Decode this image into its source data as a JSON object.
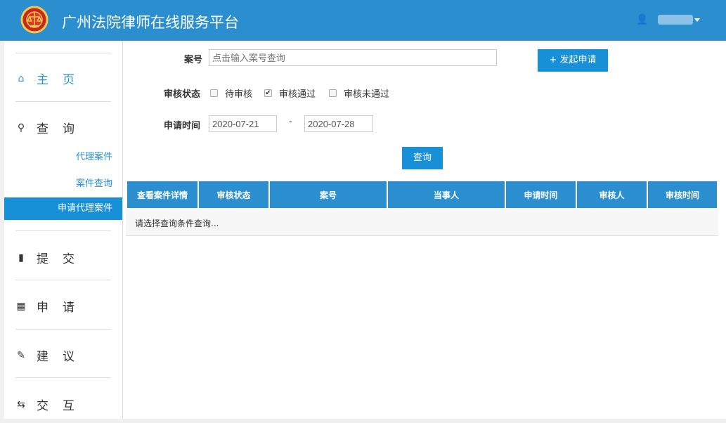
{
  "header": {
    "title": "广州法院律师在线服务平台",
    "user_name": "用户"
  },
  "sidebar": {
    "home": "主页",
    "query": "查询",
    "sub": [
      "代理案件",
      "案件查询",
      "申请代理案件"
    ],
    "submit": "提交",
    "apply": "申请",
    "suggest": "建议",
    "interact": "交互"
  },
  "form": {
    "case_label": "案号",
    "case_placeholder": "点击输入案号查询",
    "case_value": "",
    "new_btn": "+ 发起申请",
    "status_label": "审核状态",
    "status_options": [
      {
        "label": "待审核",
        "checked": false
      },
      {
        "label": "审核通过",
        "checked": true
      },
      {
        "label": "审核未通过",
        "checked": false
      }
    ],
    "date_label": "申请时间",
    "date_from": "2020-07-21",
    "date_sep": "-",
    "date_to": "2020-07-28",
    "query_btn": "查询"
  },
  "table": {
    "headers": [
      "查看案件详情",
      "审核状态",
      "案号",
      "当事人",
      "申请时间",
      "审核人",
      "审核时间"
    ],
    "empty": "请选择查询条件查询..."
  }
}
